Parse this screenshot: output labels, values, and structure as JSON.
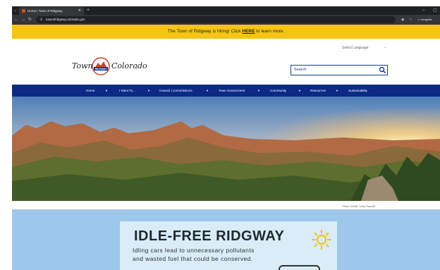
{
  "browser": {
    "tab_title": "Home | Town of Ridgway",
    "tab_close": "✕",
    "new_tab": "+",
    "url": "townofridgway.colorado.gov",
    "incognito_label": "Incognito"
  },
  "alert": {
    "text_before": "The Town of Ridgway is hiring! Click ",
    "link": "HERE",
    "text_after": " to learn more."
  },
  "header": {
    "language_label": "Select Language",
    "logo_left": "Town of",
    "logo_badge": "RIDGWAY",
    "logo_right": "Colorado",
    "search_placeholder": "Search"
  },
  "nav": {
    "items": [
      {
        "label": "Home"
      },
      {
        "label": "I Want To..."
      },
      {
        "label": "Council | Commissions"
      },
      {
        "label": "Town Government"
      },
      {
        "label": "Community"
      },
      {
        "label": "Resources"
      },
      {
        "label": "Sustainability"
      }
    ]
  },
  "hero": {
    "photo_credit": "Photo Credit: Gary Ratcliff"
  },
  "promo": {
    "headline": "IDLE-FREE RIDGWAY",
    "line1": "Idling cars lead to unnecessary pollutants",
    "line2": "and wasted fuel that could be conserved."
  },
  "colors": {
    "alert_bg": "#f6c416",
    "nav_bg": "#0a2a84",
    "promo_bg": "#9dc8eb"
  }
}
